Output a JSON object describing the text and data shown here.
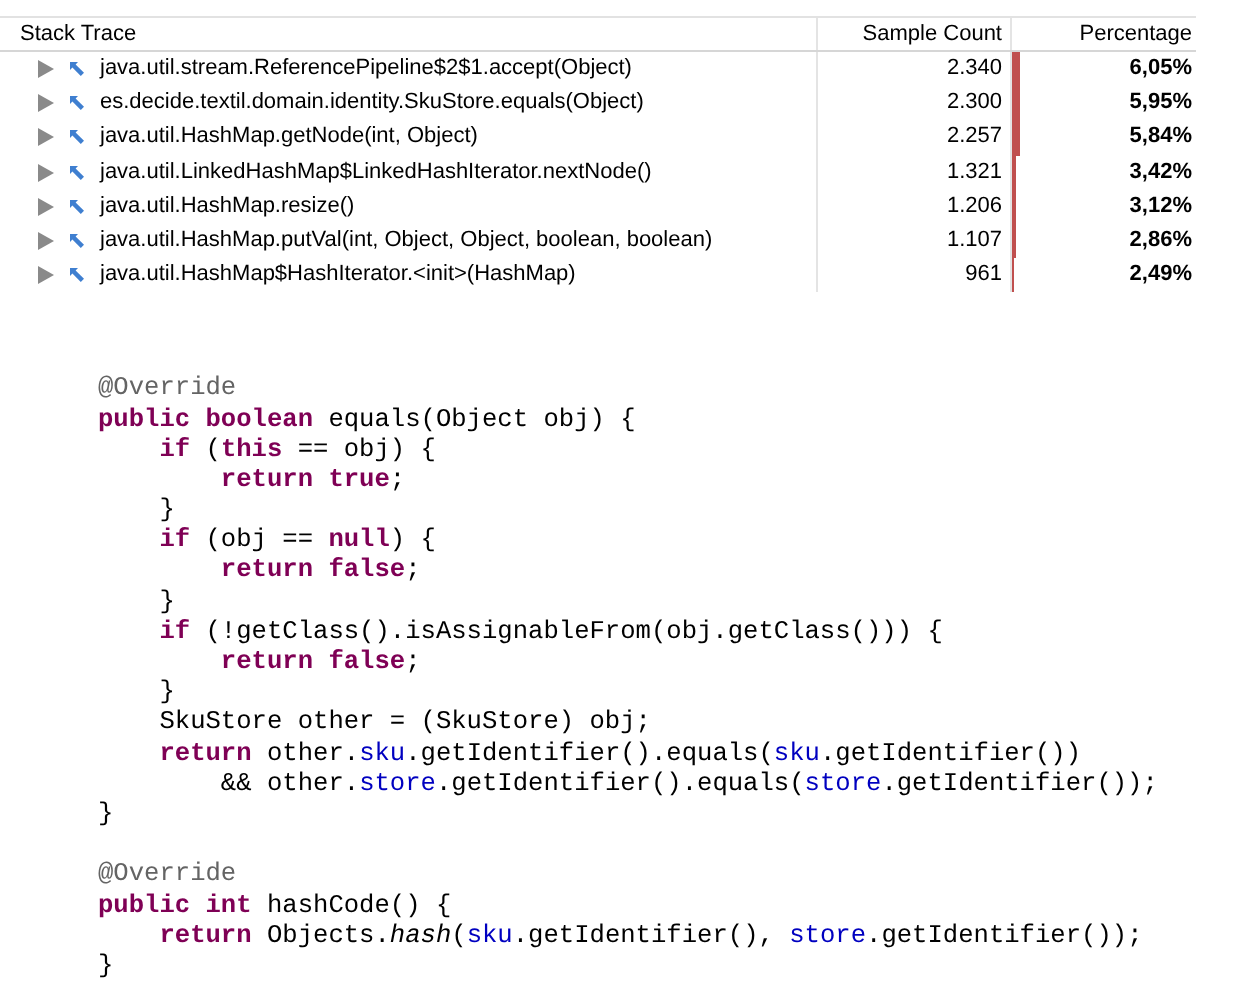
{
  "table": {
    "columns": [
      "Stack Trace",
      "Sample Count",
      "Percentage"
    ],
    "rows": [
      {
        "method": "java.util.stream.ReferencePipeline$2$1.accept(Object)",
        "count": "2.340",
        "level": 0.0605,
        "percentage": "6,05%"
      },
      {
        "method": "es.decide.textil.domain.identity.SkuStore.equals(Object)",
        "count": "2.300",
        "level": 0.0595,
        "percentage": "5,95%"
      },
      {
        "method": "java.util.HashMap.getNode(int, Object)",
        "count": "2.257",
        "level": 0.0584,
        "percentage": "5,84%"
      },
      {
        "method": "java.util.LinkedHashMap$LinkedHashIterator.nextNode()",
        "count": "1.321",
        "level": 0.0342,
        "percentage": "3,42%"
      },
      {
        "method": "java.util.HashMap.resize()",
        "count": "1.206",
        "level": 0.0312,
        "percentage": "3,12%"
      },
      {
        "method": "java.util.HashMap.putVal(int, Object, Object, boolean, boolean)",
        "count": "1.107",
        "level": 0.0286,
        "percentage": "2,86%"
      },
      {
        "method": "java.util.HashMap$HashIterator.<init>(HashMap)",
        "count": "961",
        "level": 0.0249,
        "percentage": "2,49%"
      }
    ]
  },
  "code": [
    {
      "kind": "code",
      "tokens": [
        {
          "kind": "annotation",
          "text": "@Override"
        }
      ]
    },
    {
      "kind": "code",
      "tokens": [
        {
          "kind": "keyword",
          "text": "public boolean"
        },
        {
          "kind": "plain",
          "text": " equals(Object obj) {"
        }
      ]
    },
    {
      "kind": "code",
      "tokens": [
        {
          "kind": "keyword",
          "text": "    if"
        },
        {
          "kind": "plain",
          "text": " ("
        },
        {
          "kind": "keyword",
          "text": "this"
        },
        {
          "kind": "plain",
          "text": " == obj) {"
        }
      ]
    },
    {
      "kind": "code",
      "tokens": [
        {
          "kind": "keyword",
          "text": "        return true"
        },
        {
          "kind": "plain",
          "text": ";"
        }
      ]
    },
    {
      "kind": "code",
      "tokens": [
        {
          "kind": "plain",
          "text": "    }"
        }
      ]
    },
    {
      "kind": "code",
      "tokens": [
        {
          "kind": "keyword",
          "text": "    if"
        },
        {
          "kind": "plain",
          "text": " (obj == "
        },
        {
          "kind": "keyword",
          "text": "null"
        },
        {
          "kind": "plain",
          "text": ") {"
        }
      ]
    },
    {
      "kind": "code",
      "tokens": [
        {
          "kind": "keyword",
          "text": "        return false"
        },
        {
          "kind": "plain",
          "text": ";"
        }
      ]
    },
    {
      "kind": "code",
      "tokens": [
        {
          "kind": "plain",
          "text": "    }"
        }
      ]
    },
    {
      "kind": "code",
      "tokens": [
        {
          "kind": "keyword",
          "text": "    if"
        },
        {
          "kind": "plain",
          "text": " (!getClass().isAssignableFrom(obj.getClass())) {"
        }
      ]
    },
    {
      "kind": "code",
      "tokens": [
        {
          "kind": "keyword",
          "text": "        return false"
        },
        {
          "kind": "plain",
          "text": ";"
        }
      ]
    },
    {
      "kind": "code",
      "tokens": [
        {
          "kind": "plain",
          "text": "    }"
        }
      ]
    },
    {
      "kind": "code",
      "tokens": [
        {
          "kind": "plain",
          "text": "    SkuStore other = (SkuStore) obj;"
        }
      ]
    },
    {
      "kind": "code",
      "tokens": [
        {
          "kind": "keyword",
          "text": "    return"
        },
        {
          "kind": "plain",
          "text": " other."
        },
        {
          "kind": "field",
          "text": "sku"
        },
        {
          "kind": "plain",
          "text": ".getIdentifier().equals("
        },
        {
          "kind": "field",
          "text": "sku"
        },
        {
          "kind": "plain",
          "text": ".getIdentifier())"
        }
      ]
    },
    {
      "kind": "code",
      "tokens": [
        {
          "kind": "plain",
          "text": "        && other."
        },
        {
          "kind": "field",
          "text": "store"
        },
        {
          "kind": "plain",
          "text": ".getIdentifier().equals("
        },
        {
          "kind": "field",
          "text": "store"
        },
        {
          "kind": "plain",
          "text": ".getIdentifier());"
        }
      ]
    },
    {
      "kind": "code",
      "tokens": [
        {
          "kind": "plain",
          "text": "}"
        }
      ]
    },
    {
      "kind": "blank"
    },
    {
      "kind": "code",
      "tokens": [
        {
          "kind": "annotation",
          "text": "@Override"
        }
      ]
    },
    {
      "kind": "code",
      "tokens": [
        {
          "kind": "keyword",
          "text": "public int"
        },
        {
          "kind": "plain",
          "text": " hashCode() {"
        }
      ]
    },
    {
      "kind": "code",
      "tokens": [
        {
          "kind": "keyword",
          "text": "    return"
        },
        {
          "kind": "plain",
          "text": " Objects."
        },
        {
          "kind": "static",
          "text": "hash"
        },
        {
          "kind": "plain",
          "text": "("
        },
        {
          "kind": "field",
          "text": "sku"
        },
        {
          "kind": "plain",
          "text": ".getIdentifier(), "
        },
        {
          "kind": "field",
          "text": "store"
        },
        {
          "kind": "plain",
          "text": ".getIdentifier());"
        }
      ]
    },
    {
      "kind": "code",
      "tokens": [
        {
          "kind": "plain",
          "text": "}"
        }
      ]
    }
  ]
}
